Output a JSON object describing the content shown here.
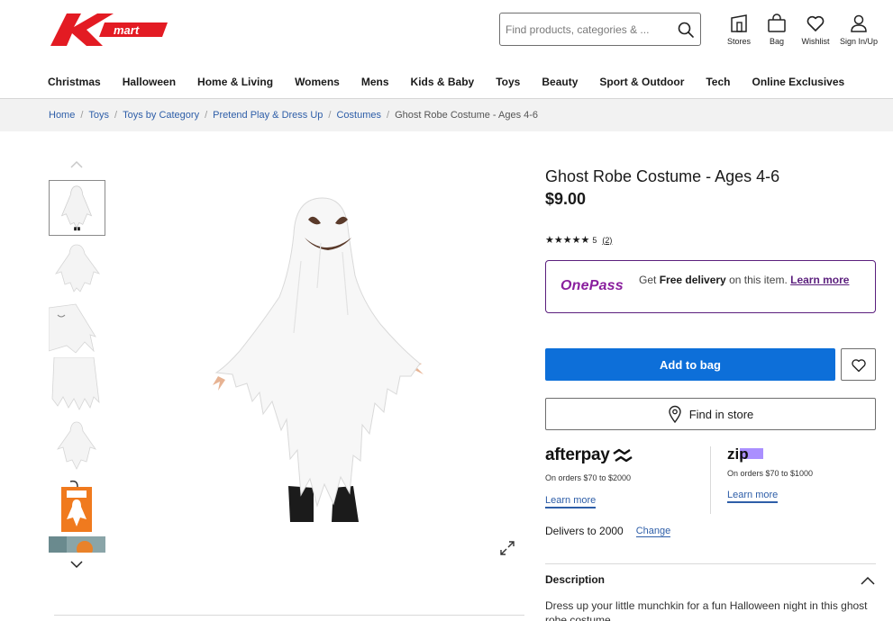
{
  "brand": {
    "logo_text": "mart",
    "accent": "#e31b23"
  },
  "search": {
    "placeholder": "Find products, categories & ..."
  },
  "header_icons": [
    {
      "name": "stores",
      "label": "Stores",
      "icon": "store-icon"
    },
    {
      "name": "bag",
      "label": "Bag",
      "icon": "bag-icon"
    },
    {
      "name": "wishlist",
      "label": "Wishlist",
      "icon": "heart-icon"
    },
    {
      "name": "account",
      "label": "Sign In/Up",
      "icon": "user-icon"
    }
  ],
  "nav": [
    "Christmas",
    "Halloween",
    "Home & Living",
    "Womens",
    "Mens",
    "Kids & Baby",
    "Toys",
    "Beauty",
    "Sport & Outdoor",
    "Tech",
    "Online Exclusives"
  ],
  "breadcrumb": {
    "links": [
      "Home",
      "Toys",
      "Toys by Category",
      "Pretend Play & Dress Up",
      "Costumes"
    ],
    "current": "Ghost Robe Costume - Ages 4-6"
  },
  "product": {
    "title": "Ghost Robe Costume - Ages 4-6",
    "price": "$9.00",
    "rating": {
      "stars": 5,
      "score_text": "5",
      "count_text": "(2)"
    }
  },
  "onepass": {
    "logo": "OnePass",
    "text_prefix": "Get",
    "text_bold": "Free delivery",
    "text_suffix": "on this item.",
    "link": "Learn more",
    "color": "#5b1f7d"
  },
  "actions": {
    "add_to_bag": "Add to bag",
    "find_in_store": "Find in store",
    "button_color": "#0d6fd9"
  },
  "payments": {
    "afterpay": {
      "logo": "afterpay",
      "note": "On orders $70 to $2000",
      "link": "Learn more"
    },
    "zip": {
      "logo": "zip",
      "note": "On orders $70 to $1000",
      "link": "Learn more"
    }
  },
  "delivery": {
    "text": "Delivers to 2000",
    "change": "Change"
  },
  "description": {
    "heading": "Description",
    "body": "Dress up your little munchkin for a fun Halloween night in this ghost robe costume."
  }
}
